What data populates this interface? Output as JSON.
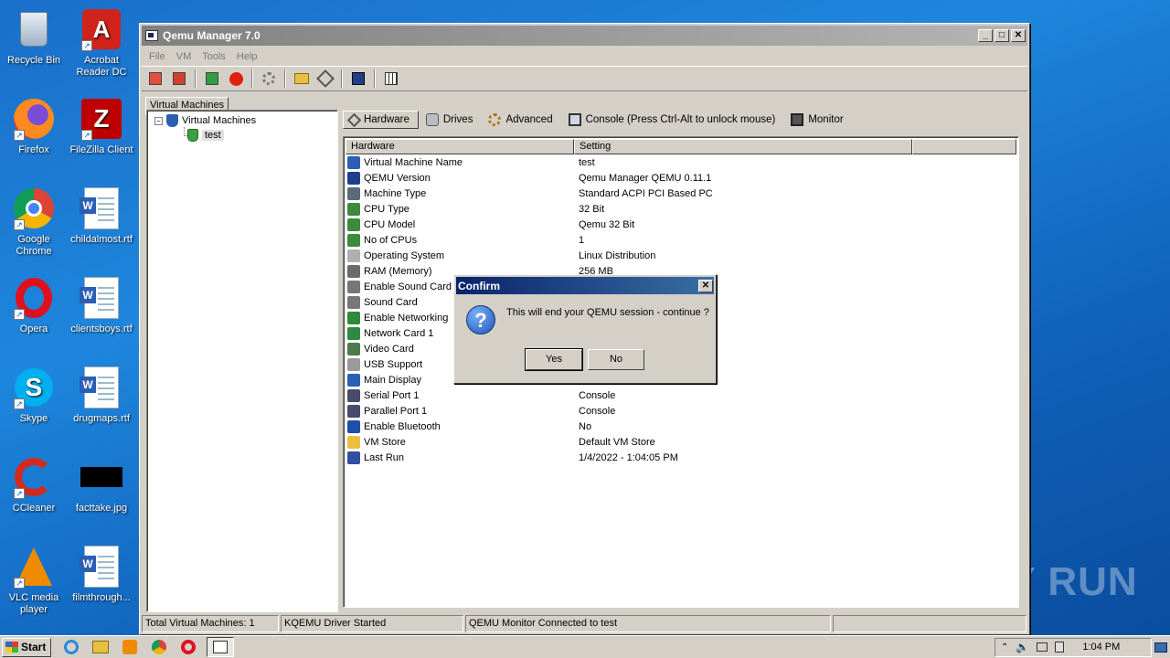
{
  "desktop": {
    "icons": [
      {
        "label": "Recycle Bin"
      },
      {
        "label": "Acrobat Reader DC"
      },
      {
        "label": "Firefox"
      },
      {
        "label": "FileZilla Client"
      },
      {
        "label": "Google Chrome"
      },
      {
        "label": "childalmost.rtf"
      },
      {
        "label": "Opera"
      },
      {
        "label": "clientsboys.rtf"
      },
      {
        "label": "Skype"
      },
      {
        "label": "drugmaps.rtf"
      },
      {
        "label": "CCleaner"
      },
      {
        "label": "facttake.jpg"
      },
      {
        "label": "VLC media player"
      },
      {
        "label": "filmthrough..."
      }
    ],
    "watermark": "ANY RUN"
  },
  "window": {
    "title": "Qemu Manager 7.0",
    "menu": [
      "File",
      "VM",
      "Tools",
      "Help"
    ],
    "tab": "Virtual Machines",
    "tree": {
      "root": "Virtual Machines",
      "child": "test"
    },
    "inner_tabs": [
      "Hardware",
      "Drives",
      "Advanced",
      "Console (Press Ctrl-Alt to unlock mouse)",
      "Monitor"
    ],
    "grid": {
      "headers": [
        "Hardware",
        "Setting"
      ],
      "rows": [
        {
          "name": "Virtual Machine Name",
          "value": "test",
          "icon": "shield-icon",
          "color": "#2b5fb4"
        },
        {
          "name": "QEMU Version",
          "value": "Qemu Manager QEMU 0.11.1",
          "icon": "disk-icon",
          "color": "#1f3f8a"
        },
        {
          "name": "Machine Type",
          "value": "Standard ACPI PCI Based PC",
          "icon": "computer-icon",
          "color": "#5a6b7c"
        },
        {
          "name": "CPU Type",
          "value": "32 Bit",
          "icon": "chip-icon",
          "color": "#3c8a3c"
        },
        {
          "name": "CPU Model",
          "value": "Qemu 32 Bit",
          "icon": "chip-icon",
          "color": "#3c8a3c"
        },
        {
          "name": "No of CPUs",
          "value": "1",
          "icon": "chip-icon",
          "color": "#3c8a3c"
        },
        {
          "name": "Operating System",
          "value": "Linux Distribution",
          "icon": "cd-icon",
          "color": "#b0b0b0"
        },
        {
          "name": "RAM (Memory)",
          "value": "256 MB",
          "icon": "memory-icon",
          "color": "#6b6b6b"
        },
        {
          "name": "Enable Sound Card",
          "value": "",
          "icon": "speaker-icon",
          "color": "#777777"
        },
        {
          "name": "Sound Card",
          "value": "",
          "icon": "speaker-icon",
          "color": "#777777"
        },
        {
          "name": "Enable Networking",
          "value": "",
          "icon": "network-icon",
          "color": "#2f8a3f"
        },
        {
          "name": "Network Card 1",
          "value": "",
          "icon": "network-icon",
          "color": "#2f8a3f"
        },
        {
          "name": "Video Card",
          "value": "",
          "icon": "video-icon",
          "color": "#4c7a4c"
        },
        {
          "name": "USB Support",
          "value": "",
          "icon": "usb-icon",
          "color": "#9a9a9a"
        },
        {
          "name": "Main Display",
          "value": "",
          "icon": "display-icon",
          "color": "#2b5fb4"
        },
        {
          "name": "Serial Port 1",
          "value": "Console",
          "icon": "port-icon",
          "color": "#4a4a6a"
        },
        {
          "name": "Parallel Port 1",
          "value": "Console",
          "icon": "port-icon",
          "color": "#4a4a6a"
        },
        {
          "name": "Enable Bluetooth",
          "value": "No",
          "icon": "bluetooth-icon",
          "color": "#1f4fa8"
        },
        {
          "name": "VM Store",
          "value": "Default VM Store",
          "icon": "folder-icon",
          "color": "#e8c040"
        },
        {
          "name": "Last Run",
          "value": "1/4/2022 - 1:04:05 PM",
          "icon": "calendar-icon",
          "color": "#3050a0"
        }
      ]
    },
    "status": [
      "Total Virtual Machines: 1",
      "KQEMU Driver Started",
      "QEMU Monitor Connected to test",
      ""
    ]
  },
  "dialog": {
    "title": "Confirm",
    "message": "This will end your QEMU session - continue ?",
    "yes": "Yes",
    "no": "No"
  },
  "taskbar": {
    "start": "Start",
    "clock": "1:04 PM"
  }
}
